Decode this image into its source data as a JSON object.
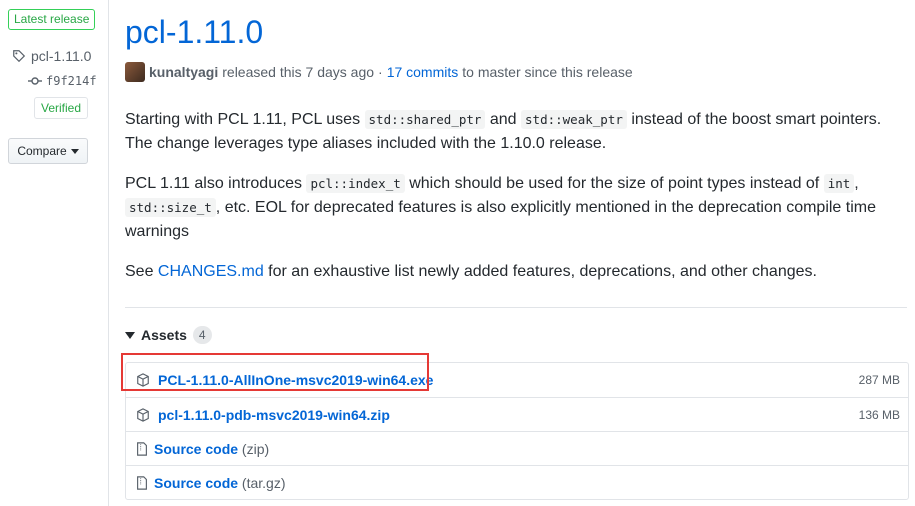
{
  "sidebar": {
    "latest_label": "Latest release",
    "tag": "pcl-1.11.0",
    "commit": "f9f214f",
    "verified": "Verified",
    "compare": "Compare"
  },
  "release": {
    "title": "pcl-1.11.0",
    "author": "kunaltyagi",
    "released_text": "released this 7 days ago",
    "separator": "·",
    "commits_link": "17 commits",
    "commits_suffix": "to master since this release"
  },
  "body": {
    "p1_a": "Starting with PCL 1.11, PCL uses",
    "p1_code1": "std::shared_ptr",
    "p1_b": "and",
    "p1_code2": "std::weak_ptr",
    "p1_c": "instead of the boost smart pointers. The change leverages type aliases included with the 1.10.0 release.",
    "p2_a": "PCL 1.11 also introduces",
    "p2_code1": "pcl::index_t",
    "p2_b": "which should be used for the size of point types instead of",
    "p2_code2": "int",
    "p2_c": ",",
    "p2_code3": "std::size_t",
    "p2_d": ", etc. EOL for deprecated features is also explicitly mentioned in the deprecation compile time warnings",
    "p3_a": "See",
    "p3_link": "CHANGES.md",
    "p3_b": "for an exhaustive list newly added features, deprecations, and other changes."
  },
  "assets": {
    "heading": "Assets",
    "count": "4",
    "items": [
      {
        "name": "PCL-1.11.0-AllInOne-msvc2019-win64.exe",
        "suffix": "",
        "size": "287 MB"
      },
      {
        "name": "pcl-1.11.0-pdb-msvc2019-win64.zip",
        "suffix": "",
        "size": "136 MB"
      },
      {
        "name": "Source code",
        "suffix": "(zip)",
        "size": ""
      },
      {
        "name": "Source code",
        "suffix": "(tar.gz)",
        "size": ""
      }
    ]
  },
  "colors": {
    "accent": "#0366d6",
    "highlight": "#e53935",
    "success": "#28a745"
  }
}
